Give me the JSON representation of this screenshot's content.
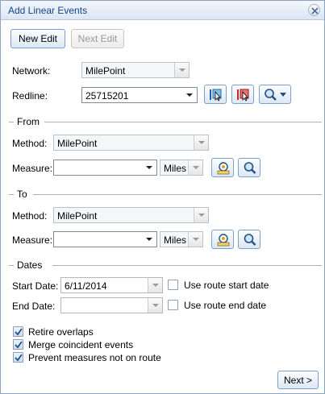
{
  "window": {
    "title": "Add Linear Events"
  },
  "toolbar": {
    "new_edit": "New Edit",
    "next_edit": "Next Edit"
  },
  "network": {
    "label": "Network:",
    "value": "MilePoint"
  },
  "redline": {
    "label": "Redline:",
    "value": "25715201"
  },
  "from": {
    "title": "From",
    "method_label": "Method:",
    "method_value": "MilePoint",
    "measure_label": "Measure:",
    "measure_value": "",
    "units_value": "Miles"
  },
  "to": {
    "title": "To",
    "method_label": "Method:",
    "method_value": "MilePoint",
    "measure_label": "Measure:",
    "measure_value": "",
    "units_value": "Miles"
  },
  "dates": {
    "title": "Dates",
    "start_label": "Start Date:",
    "start_value": "6/11/2014",
    "use_start_label": "Use route start date",
    "end_label": "End Date:",
    "end_value": "",
    "use_end_label": "Use route end date"
  },
  "options": {
    "retire_overlaps": "Retire overlaps",
    "merge_coincident": "Merge coincident events",
    "prevent_measures": "Prevent measures not on route"
  },
  "footer": {
    "next": "Next >"
  },
  "icons": {
    "close": "close-icon",
    "select_route": "select-route-icon",
    "clear_selection": "clear-selection-icon",
    "zoom_dropdown": "magnifier-dropdown-icon",
    "measure_tool": "measure-tool-icon",
    "zoom_to": "magnifier-icon"
  }
}
